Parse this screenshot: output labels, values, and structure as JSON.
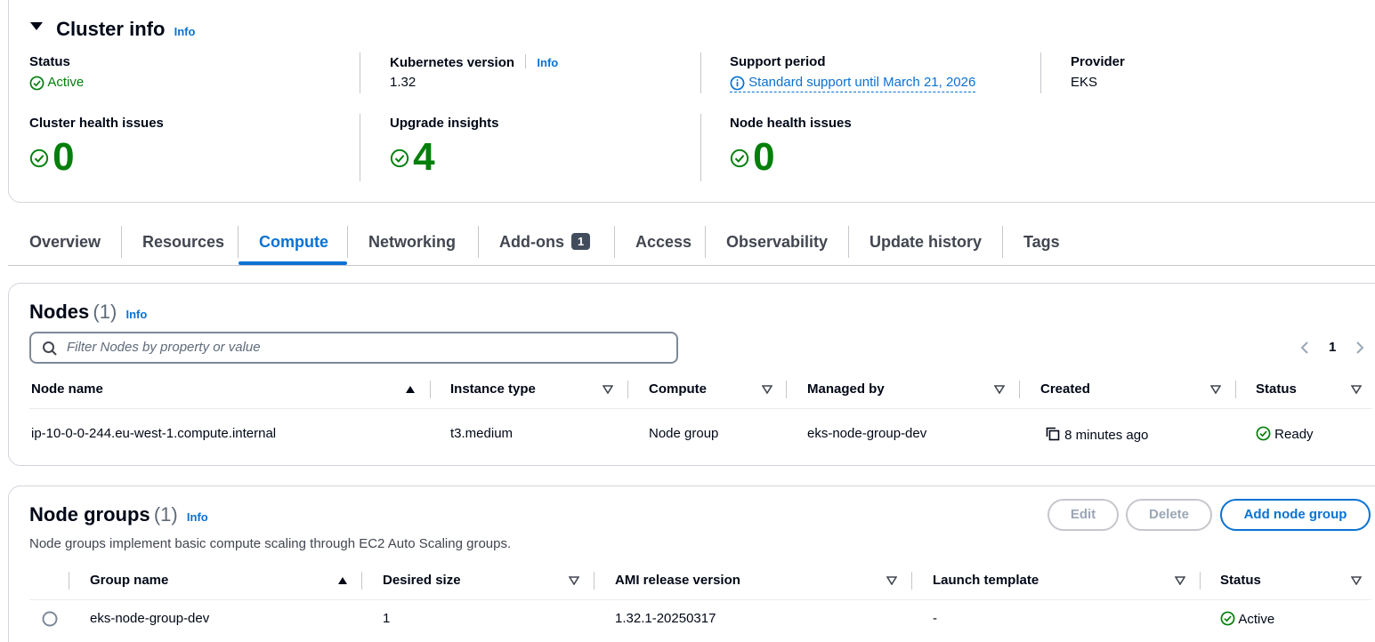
{
  "cluster_info": {
    "title": "Cluster info",
    "info": "Info",
    "status": {
      "label": "Status",
      "value": "Active"
    },
    "k8s_version": {
      "label": "Kubernetes version",
      "info": "Info",
      "value": "1.32"
    },
    "support_period": {
      "label": "Support period",
      "value": "Standard support until March 21, 2026"
    },
    "provider": {
      "label": "Provider",
      "value": "EKS"
    },
    "cluster_health": {
      "label": "Cluster health issues",
      "value": "0"
    },
    "upgrade_insights": {
      "label": "Upgrade insights",
      "value": "4"
    },
    "node_health": {
      "label": "Node health issues",
      "value": "0"
    }
  },
  "tabs": [
    {
      "label": "Overview"
    },
    {
      "label": "Resources"
    },
    {
      "label": "Compute",
      "active": true
    },
    {
      "label": "Networking"
    },
    {
      "label": "Add-ons",
      "badge": "1"
    },
    {
      "label": "Access"
    },
    {
      "label": "Observability"
    },
    {
      "label": "Update history"
    },
    {
      "label": "Tags"
    }
  ],
  "nodes": {
    "title": "Nodes",
    "count": "(1)",
    "info": "Info",
    "filter_placeholder": "Filter Nodes by property or value",
    "page": "1",
    "columns": [
      "Node name",
      "Instance type",
      "Compute",
      "Managed by",
      "Created",
      "Status"
    ],
    "rows": [
      {
        "node_name": "ip-10-0-0-244.eu-west-1.compute.internal",
        "instance_type": "t3.medium",
        "compute": "Node group",
        "managed_by": "eks-node-group-dev",
        "created": "8 minutes ago",
        "status": "Ready"
      }
    ]
  },
  "node_groups": {
    "title": "Node groups",
    "count": "(1)",
    "info": "Info",
    "description": "Node groups implement basic compute scaling through EC2 Auto Scaling groups.",
    "buttons": {
      "edit": "Edit",
      "delete": "Delete",
      "add": "Add node group"
    },
    "columns": [
      "Group name",
      "Desired size",
      "AMI release version",
      "Launch template",
      "Status"
    ],
    "rows": [
      {
        "group_name": "eks-node-group-dev",
        "desired_size": "1",
        "ami_release": "1.32.1-20250317",
        "launch_template": "-",
        "status": "Active"
      }
    ]
  },
  "colors": {
    "link": "#0972d3",
    "success": "#037f0c",
    "text": "#000716",
    "border": "#d1d5db"
  }
}
